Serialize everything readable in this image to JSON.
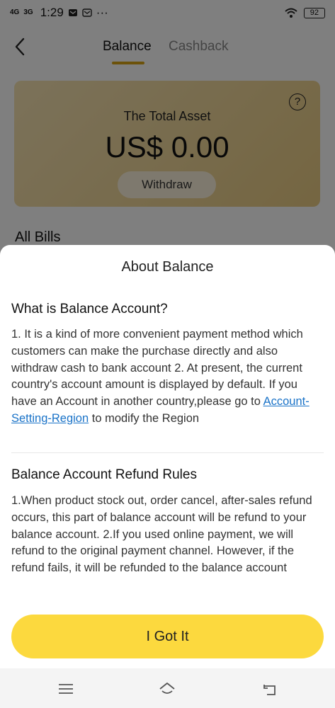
{
  "status_bar": {
    "signal_1": "4G",
    "signal_2": "3G",
    "time": "1:29",
    "dots": "···",
    "battery": "92"
  },
  "nav": {
    "tabs": [
      {
        "label": "Balance",
        "active": true
      },
      {
        "label": "Cashback",
        "active": false
      }
    ]
  },
  "asset_card": {
    "label": "The Total Asset",
    "value": "US$ 0.00",
    "help": "?",
    "withdraw_label": "Withdraw"
  },
  "all_bills_label": "All Bills",
  "sheet": {
    "title": "About Balance",
    "section1": {
      "heading": "What is Balance Account?",
      "body_before_link": "1. It is a kind of more convenient payment method which customers can  make the purchase directly and also withdraw cash to bank account 2. At present, the current country's account amount is displayed by default. If you have an Account in another country,please go to ",
      "link_text": "Account-Setting-Region",
      "body_after_link": " to modify the Region"
    },
    "section2": {
      "heading": "Balance Account Refund Rules",
      "body": "1.When product stock out, order cancel, after-sales refund occurs, this part of balance account will be refund to your balance account.  2.If you used online payment, we will refund to the original payment channel. However, if the refund fails, it will be refunded to the balance account"
    },
    "confirm_label": "I Got It"
  },
  "colors": {
    "accent": "#fcd93e",
    "tab_underline": "#d9a514",
    "link": "#1a73c8",
    "card_gradient_start": "#f7e4b4",
    "card_gradient_end": "#eacc83"
  },
  "icons": {
    "back": "chevron-left-icon",
    "help": "question-circle-icon",
    "wifi": "wifi-icon",
    "menu": "menu-icon",
    "home": "home-icon",
    "return": "return-icon"
  }
}
